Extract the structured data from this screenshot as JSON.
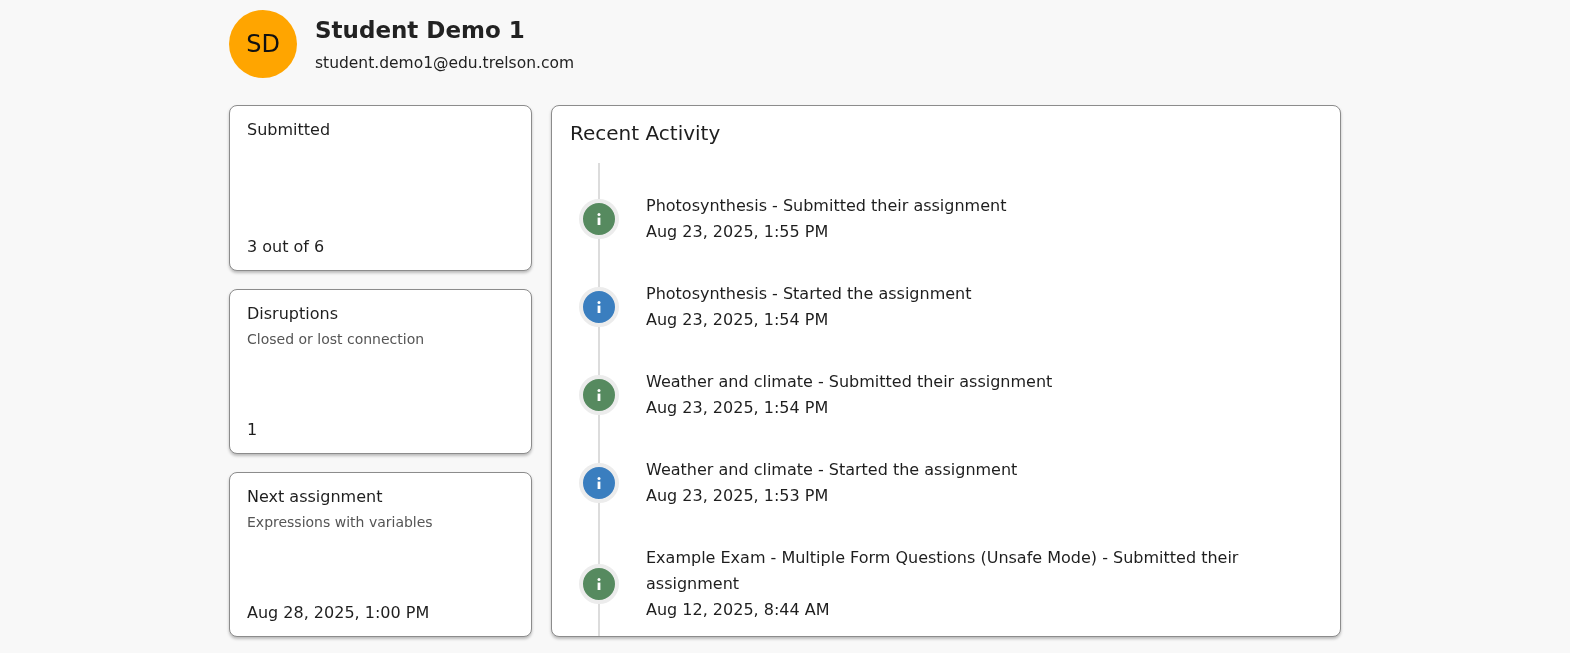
{
  "profile": {
    "initials": "SD",
    "name": "Student Demo 1",
    "email": "student.demo1@edu.trelson.com"
  },
  "stat_cards": [
    {
      "title": "Submitted",
      "value": "3 out of 6"
    },
    {
      "title": "Disruptions",
      "subtitle": "Closed or lost connection",
      "value": "1"
    },
    {
      "title": "Next assignment",
      "subtitle": "Expressions with variables",
      "value": "Aug 28, 2025, 1:00 PM"
    }
  ],
  "activity": {
    "title": "Recent Activity",
    "items": [
      {
        "text": "Photosynthesis - Submitted their assignment",
        "time": "Aug 23, 2025, 1:55 PM",
        "color": "#568a5f"
      },
      {
        "text": "Photosynthesis - Started the assignment",
        "time": "Aug 23, 2025, 1:54 PM",
        "color": "#3a7ebf"
      },
      {
        "text": "Weather and climate - Submitted their assignment",
        "time": "Aug 23, 2025, 1:54 PM",
        "color": "#568a5f"
      },
      {
        "text": "Weather and climate - Started the assignment",
        "time": "Aug 23, 2025, 1:53 PM",
        "color": "#3a7ebf"
      },
      {
        "text": "Example Exam - Multiple Form Questions (Unsafe Mode) - Submitted their assignment",
        "time": "Aug 12, 2025, 8:44 AM",
        "color": "#568a5f"
      }
    ]
  }
}
